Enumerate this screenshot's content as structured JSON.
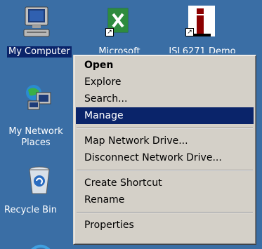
{
  "desktop": {
    "icons": {
      "my_computer": "My Computer",
      "excel": "Microsoft",
      "isl": "ISL6271 Demo",
      "network": "My Network\nPlaces",
      "recycle": "Recycle Bin"
    },
    "colors": {
      "background": "#3a6ea5",
      "selection": "#0a246a"
    }
  },
  "context_menu": {
    "items": [
      "Open",
      "Explore",
      "Search...",
      "Manage",
      "Map Network Drive...",
      "Disconnect Network Drive...",
      "Create Shortcut",
      "Rename",
      "Properties"
    ],
    "highlighted": "Manage"
  }
}
